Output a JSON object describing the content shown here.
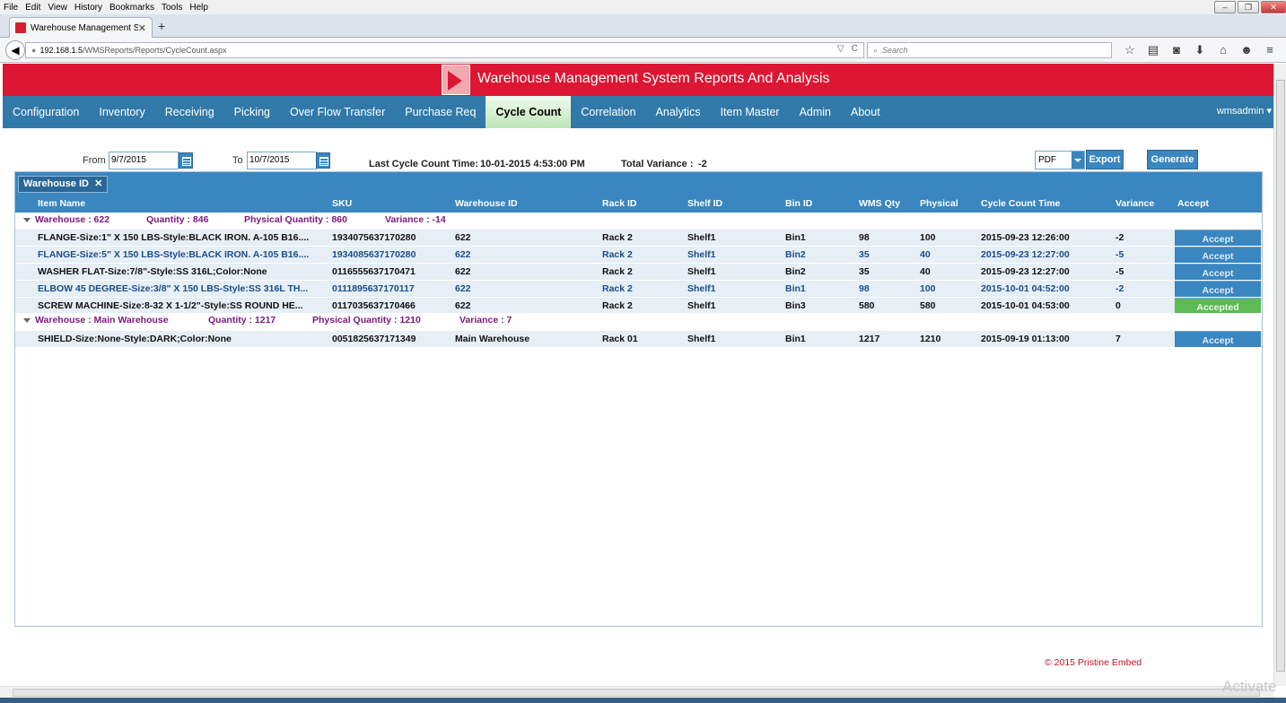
{
  "browser": {
    "menu": [
      "File",
      "Edit",
      "View",
      "History",
      "Bookmarks",
      "Tools",
      "Help"
    ],
    "tab_title": "Warehouse Management S...",
    "url_host": "192.168.1.5",
    "url_path": "/WMSReports/Reports/CycleCount.aspx",
    "search_placeholder": "Search"
  },
  "app": {
    "title": "Warehouse Management System Reports And Analysis",
    "nav": [
      "Configuration",
      "Inventory",
      "Receiving",
      "Picking",
      "Over Flow Transfer",
      "Purchase Req",
      "Cycle Count",
      "Correlation",
      "Analytics",
      "Item Master",
      "Admin",
      "About"
    ],
    "active_nav": "Cycle Count",
    "user": "wmsadmin"
  },
  "filters": {
    "from_label": "From",
    "from_value": "9/7/2015",
    "to_label": "To",
    "to_value": "10/7/2015",
    "last_cycle_label": "Last Cycle Count Time:",
    "last_cycle_value": "10-01-2015 4:53:00 PM",
    "total_variance_label": "Total Variance :",
    "total_variance_value": "-2",
    "export_format": "PDF",
    "export_label": "Export",
    "generate_label": "Generate"
  },
  "grid": {
    "group_chip": "Warehouse ID",
    "columns": [
      "Item Name",
      "SKU",
      "Warehouse ID",
      "Rack ID",
      "Shelf ID",
      "Bin ID",
      "WMS Qty",
      "Physical",
      "Cycle Count Time",
      "Variance",
      "Accept"
    ],
    "groups": [
      {
        "warehouse": "Warehouse : 622",
        "quantity": "Quantity : 846",
        "physical": "Physical Quantity : 860",
        "variance": "Variance : -14",
        "rows": [
          {
            "item": "FLANGE-Size:1\" X 150 LBS-Style:BLACK IRON. A-105 B16....",
            "sku": "1934075637170280",
            "wh": "622",
            "rack": "Rack 2",
            "shelf": "Shelf1",
            "bin": "Bin1",
            "wms": "98",
            "phys": "100",
            "time": "2015-09-23 12:26:00",
            "var": "-2",
            "accept": "Accept"
          },
          {
            "item": "FLANGE-Size:5\" X 150 LBS-Style:BLACK IRON. A-105 B16....",
            "sku": "1934085637170280",
            "wh": "622",
            "rack": "Rack 2",
            "shelf": "Shelf1",
            "bin": "Bin2",
            "wms": "35",
            "phys": "40",
            "time": "2015-09-23 12:27:00",
            "var": "-5",
            "accept": "Accept"
          },
          {
            "item": "WASHER FLAT-Size:7/8\"-Style:SS 316L;Color:None",
            "sku": "0116555637170471",
            "wh": "622",
            "rack": "Rack 2",
            "shelf": "Shelf1",
            "bin": "Bin2",
            "wms": "35",
            "phys": "40",
            "time": "2015-09-23 12:27:00",
            "var": "-5",
            "accept": "Accept"
          },
          {
            "item": "ELBOW 45 DEGREE-Size:3/8\" X 150 LBS-Style:SS 316L TH...",
            "sku": "0111895637170117",
            "wh": "622",
            "rack": "Rack 2",
            "shelf": "Shelf1",
            "bin": "Bin1",
            "wms": "98",
            "phys": "100",
            "time": "2015-10-01 04:52:00",
            "var": "-2",
            "accept": "Accept"
          },
          {
            "item": "SCREW MACHINE-Size:8-32 X 1-1/2\"-Style:SS ROUND HE...",
            "sku": "0117035637170466",
            "wh": "622",
            "rack": "Rack 2",
            "shelf": "Shelf1",
            "bin": "Bin3",
            "wms": "580",
            "phys": "580",
            "time": "2015-10-01 04:53:00",
            "var": "0",
            "accept": "Accepted"
          }
        ]
      },
      {
        "warehouse": "Warehouse : Main Warehouse",
        "quantity": "Quantity : 1217",
        "physical": "Physical Quantity : 1210",
        "variance": "Variance : 7",
        "rows": [
          {
            "item": "SHIELD-Size:None-Style:DARK;Color:None",
            "sku": "0051825637171349",
            "wh": "Main Warehouse",
            "rack": "Rack 01",
            "shelf": "Shelf1",
            "bin": "Bin1",
            "wms": "1217",
            "phys": "1210",
            "time": "2015-09-19 01:13:00",
            "var": "7",
            "accept": "Accept"
          }
        ]
      }
    ]
  },
  "footer": "© 2015 Pristine Embed",
  "watermark": "Activate"
}
